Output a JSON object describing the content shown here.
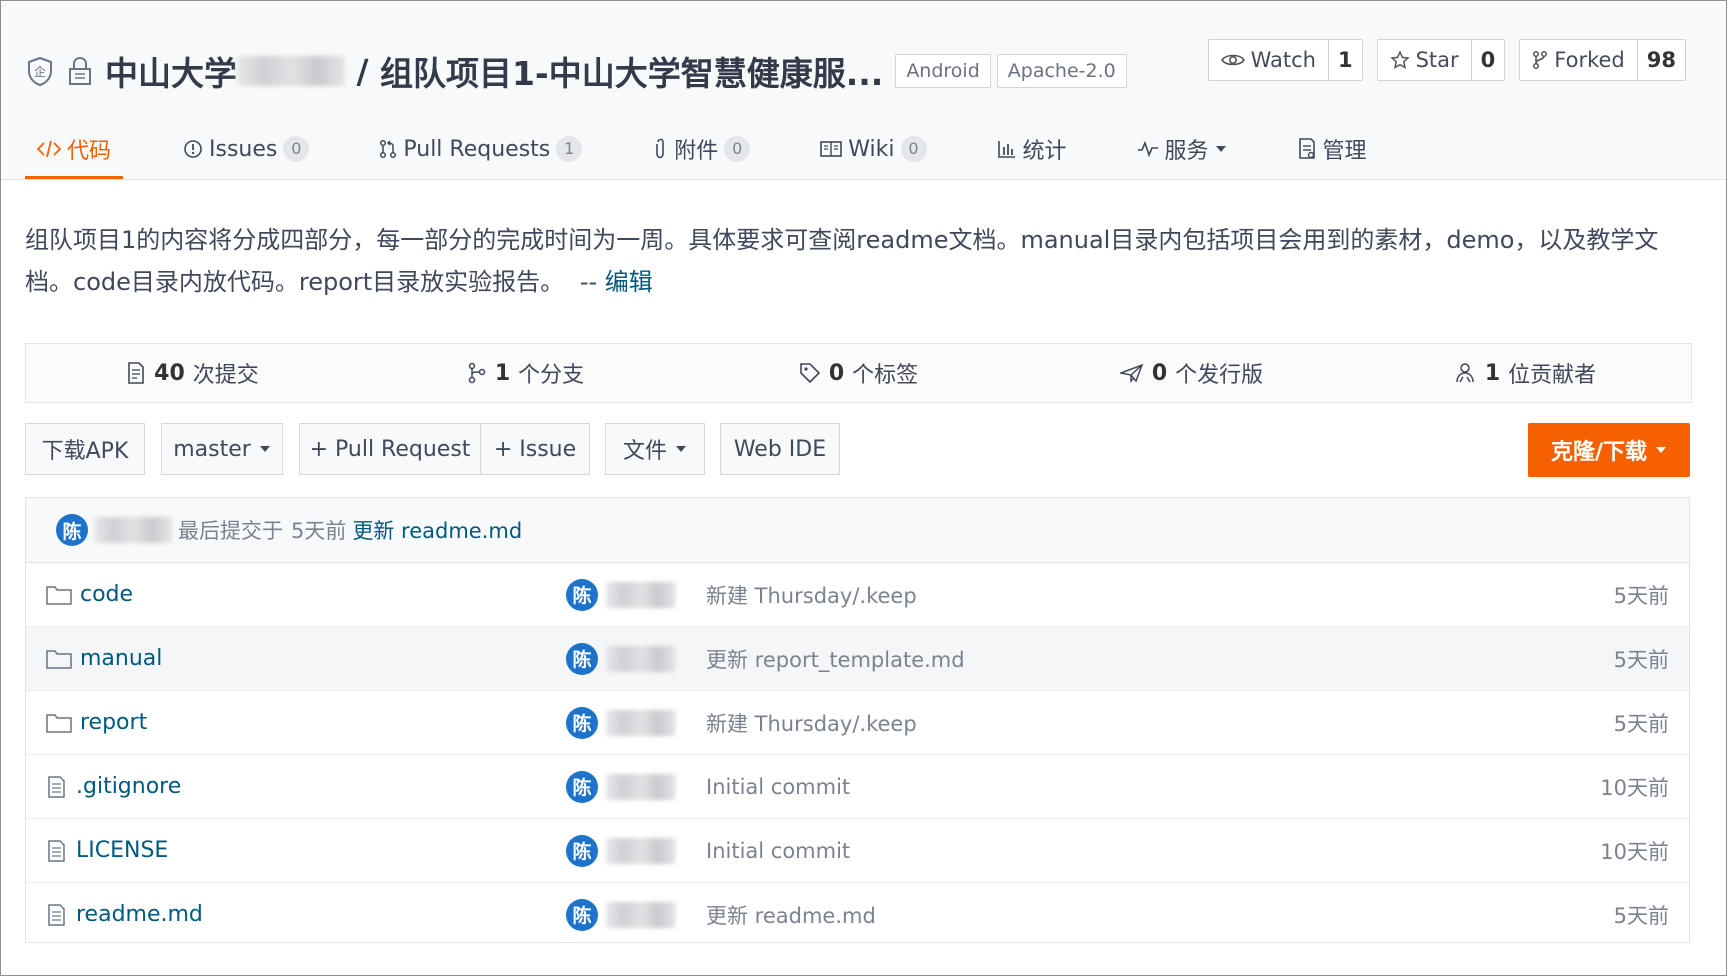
{
  "repo": {
    "org": "中山大学",
    "name": "组队项目1-中山大学智慧健康服...",
    "tags": [
      "Android",
      "Apache-2.0"
    ]
  },
  "actions": {
    "watch": {
      "label": "Watch",
      "count": "1"
    },
    "star": {
      "label": "Star",
      "count": "0"
    },
    "forked": {
      "label": "Forked",
      "count": "98"
    }
  },
  "tabs": [
    {
      "label": "代码",
      "icon": "code-icon"
    },
    {
      "label": "Issues",
      "count": "0",
      "icon": "issue-icon"
    },
    {
      "label": "Pull Requests",
      "count": "1",
      "icon": "pull-request-icon"
    },
    {
      "label": "附件",
      "count": "0",
      "icon": "paperclip-icon"
    },
    {
      "label": "Wiki",
      "count": "0",
      "icon": "book-icon"
    },
    {
      "label": "统计",
      "icon": "chart-icon"
    },
    {
      "label": "服务",
      "icon": "pulse-icon"
    },
    {
      "label": "管理",
      "icon": "manage-icon"
    }
  ],
  "description": {
    "text": "组队项目1的内容将分成四部分，每一部分的完成时间为一周。具体要求可查阅readme文档。manual目录内包括项目会用到的素材，demo，以及教学文档。code目录内放代码。report目录放实验报告。",
    "separator": "--",
    "edit": "编辑"
  },
  "stats": [
    {
      "num": "40",
      "label": "次提交",
      "icon": "commit-icon"
    },
    {
      "num": "1",
      "label": "个分支",
      "icon": "branch-icon"
    },
    {
      "num": "0",
      "label": "个标签",
      "icon": "tag-icon"
    },
    {
      "num": "0",
      "label": "个发行版",
      "icon": "release-icon"
    },
    {
      "num": "1",
      "label": "位贡献者",
      "icon": "contributors-icon"
    }
  ],
  "toolbar": {
    "download_apk": "下载APK",
    "branch": "master",
    "pull_request": "+ Pull Request",
    "issue": "+ Issue",
    "file": "文件",
    "web_ide": "Web IDE",
    "clone": "克隆/下载"
  },
  "last_commit": {
    "avatar": "陈",
    "text": "最后提交于",
    "time": "5天前",
    "message": "更新 readme.md"
  },
  "files": [
    {
      "name": "code",
      "type": "folder",
      "avatar": "陈",
      "message": "新建 Thursday/.keep",
      "time": "5天前"
    },
    {
      "name": "manual",
      "type": "folder",
      "avatar": "陈",
      "message": "更新 report_template.md",
      "time": "5天前"
    },
    {
      "name": "report",
      "type": "folder",
      "avatar": "陈",
      "message": "新建 Thursday/.keep",
      "time": "5天前"
    },
    {
      "name": ".gitignore",
      "type": "file",
      "avatar": "陈",
      "message": "Initial commit",
      "time": "10天前"
    },
    {
      "name": "LICENSE",
      "type": "file",
      "avatar": "陈",
      "message": "Initial commit",
      "time": "10天前"
    },
    {
      "name": "readme.md",
      "type": "file",
      "avatar": "陈",
      "message": "更新 readme.md",
      "time": "5天前"
    }
  ],
  "colors": {
    "accent": "#f66000",
    "link": "#005980",
    "avatar": "#1d73c9"
  }
}
